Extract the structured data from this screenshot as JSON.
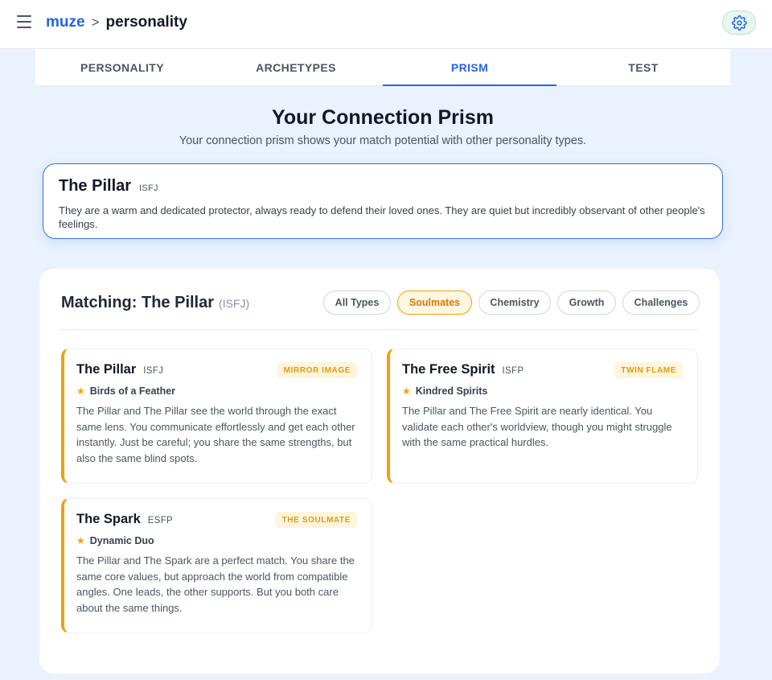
{
  "header": {
    "app_name": "muze",
    "separator": ">",
    "current_page": "personality"
  },
  "tabs": [
    {
      "label": "PERSONALITY",
      "active": false
    },
    {
      "label": "ARCHETYPES",
      "active": false
    },
    {
      "label": "PRISM",
      "active": true
    },
    {
      "label": "TEST",
      "active": false
    }
  ],
  "page": {
    "title": "Your Connection Prism",
    "subtitle": "Your connection prism shows your match potential with other personality types."
  },
  "type_card": {
    "name": "The Pillar",
    "code": "ISFJ",
    "description": "They are a warm and dedicated protector, always ready to defend their loved ones. They are quiet but incredibly observant of other people's feelings."
  },
  "matching": {
    "title": "Matching: The Pillar",
    "code": "(ISFJ)",
    "filters": [
      {
        "label": "All Types",
        "active": false
      },
      {
        "label": "Soulmates",
        "active": true
      },
      {
        "label": "Chemistry",
        "active": false
      },
      {
        "label": "Growth",
        "active": false
      },
      {
        "label": "Challenges",
        "active": false
      }
    ],
    "cards": [
      {
        "name": "The Pillar",
        "code": "ISFJ",
        "badge": "MIRROR IMAGE",
        "tag": "Birds of a Feather",
        "description": "The Pillar and The Pillar see the world through the exact same lens. You communicate effortlessly and get each other instantly. Just be careful; you share the same strengths, but also the same blind spots."
      },
      {
        "name": "The Free Spirit",
        "code": "ISFP",
        "badge": "TWIN FLAME",
        "tag": "Kindred Spirits",
        "description": "The Pillar and The Free Spirit are nearly identical. You validate each other's worldview, though you might struggle with the same practical hurdles."
      },
      {
        "name": "The Spark",
        "code": "ESFP",
        "badge": "THE SOULMATE",
        "tag": "Dynamic Duo",
        "description": "The Pillar and The Spark are a perfect match. You share the same core values, but approach the world from compatible angles. One leads, the other supports. But you both care about the same things."
      }
    ]
  },
  "colors": {
    "brand_blue": "#2563eb",
    "accent_amber": "#f59e0b",
    "page_background": "#e9f2fd",
    "settings_green": "#e6f8ef"
  },
  "icons": {
    "menu": "hamburger-icon",
    "settings": "gear-icon",
    "tag": "star-icon"
  }
}
